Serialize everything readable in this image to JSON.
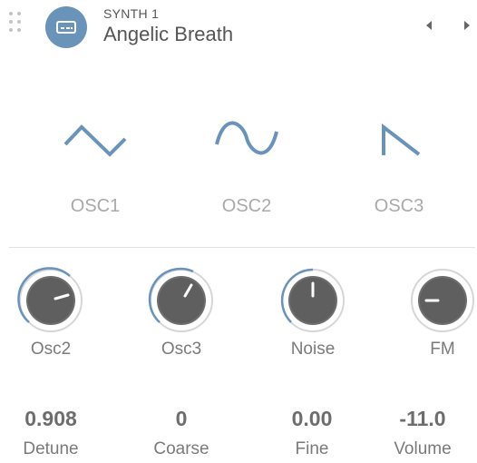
{
  "header": {
    "subtitle": "SYNTH 1",
    "title": "Angelic Breath"
  },
  "oscillators": [
    {
      "label": "OSC1",
      "icon": "triangle-wave-icon"
    },
    {
      "label": "OSC2",
      "icon": "sine-wave-icon"
    },
    {
      "label": "OSC3",
      "icon": "sawtooth-wave-icon"
    }
  ],
  "knobs": [
    {
      "label": "Osc2"
    },
    {
      "label": "Osc3"
    },
    {
      "label": "Noise"
    },
    {
      "label": "FM"
    }
  ],
  "params": [
    {
      "value": "0.908",
      "label": "Detune"
    },
    {
      "value": "0",
      "label": "Coarse"
    },
    {
      "value": "0.00",
      "label": "Fine"
    },
    {
      "value": "-11.0",
      "label": "Volume"
    }
  ],
  "colors": {
    "accent": "#6a93b9",
    "knob_body": "#6e6e6e",
    "label_gray": "#a9a9a9"
  }
}
